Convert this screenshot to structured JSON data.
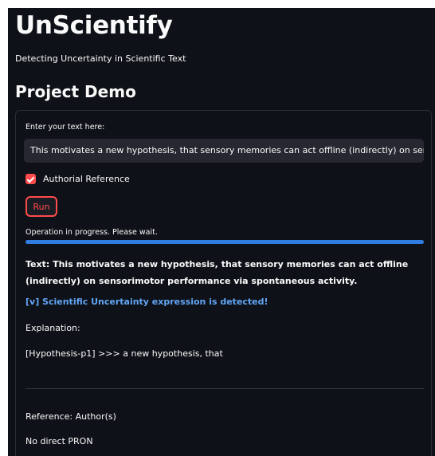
{
  "app": {
    "title": "UnScientify",
    "subtitle": "Detecting Uncertainty in Scientific Text"
  },
  "section": {
    "title": "Project Demo"
  },
  "form": {
    "input_label": "Enter your text here:",
    "input_value": "This motivates a new hypothesis, that sensory memories can act offline (indirectly) on sensorimotor performance via spontaneous activity.",
    "checkbox_label": "Authorial Reference",
    "checkbox_checked": true,
    "run_label": "Run"
  },
  "status": {
    "message": "Operation in progress. Please wait.",
    "progress_percent": 100
  },
  "result": {
    "text": "Text: This motivates a new hypothesis, that sensory memories can act offline (indirectly) on sensorimotor performance via spontaneous activity.",
    "detected": "[v] Scientific Uncertainty expression is detected!",
    "explanation_label": "Explanation:",
    "hypothesis": "[Hypothesis-p1] >>> a new hypothesis, that",
    "reference_label": "Reference: Author(s)",
    "pron": "No direct PRON"
  },
  "colors": {
    "background": "#0e1117",
    "accent": "#ff4b4b",
    "progress": "#2f7de1",
    "link": "#62a6f5"
  }
}
